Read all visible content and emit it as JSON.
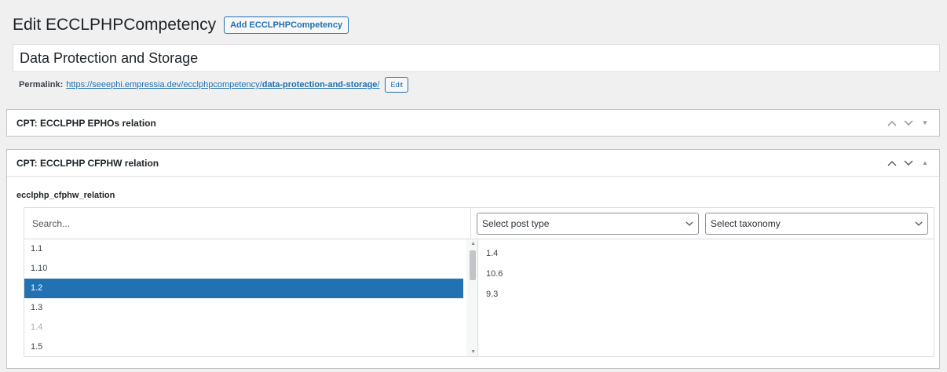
{
  "header": {
    "title": "Edit ECCLPHPCompetency",
    "add_button": "Add ECCLPHPCompetency"
  },
  "post": {
    "title": "Data Protection and Storage"
  },
  "permalink": {
    "label": "Permalink:",
    "url_base": "https://seeephi.empressia.dev/ecclphpcompetency/",
    "slug": "data-protection-and-storage",
    "url_end": "/",
    "edit_label": "Edit"
  },
  "boxes": [
    {
      "title": "CPT: ECCLPHP EPHOs relation",
      "toggle": "▼"
    },
    {
      "title": "CPT: ECCLPHP CFPHW relation",
      "toggle": "▲"
    }
  ],
  "relation": {
    "field_label": "ecclphp_cfphw_relation",
    "search_placeholder": "Search...",
    "post_type_select": "Select post type",
    "taxonomy_select": "Select taxonomy",
    "choices": [
      "1.1",
      "1.10",
      "1.2",
      "1.3",
      "1.4",
      "1.5"
    ],
    "selected_choice": "1.2",
    "disabled_choice": "1.4",
    "values": [
      "1.4",
      "10.6",
      "9.3"
    ]
  },
  "icons": {
    "move_up": "chevron-up-icon",
    "move_down": "chevron-down-icon",
    "toggle": "caret-icon",
    "select_arrow": "chevron-down-icon"
  },
  "colors": {
    "accent": "#2271b1",
    "background": "#f0f0f1",
    "border": "#c3c4c7"
  }
}
